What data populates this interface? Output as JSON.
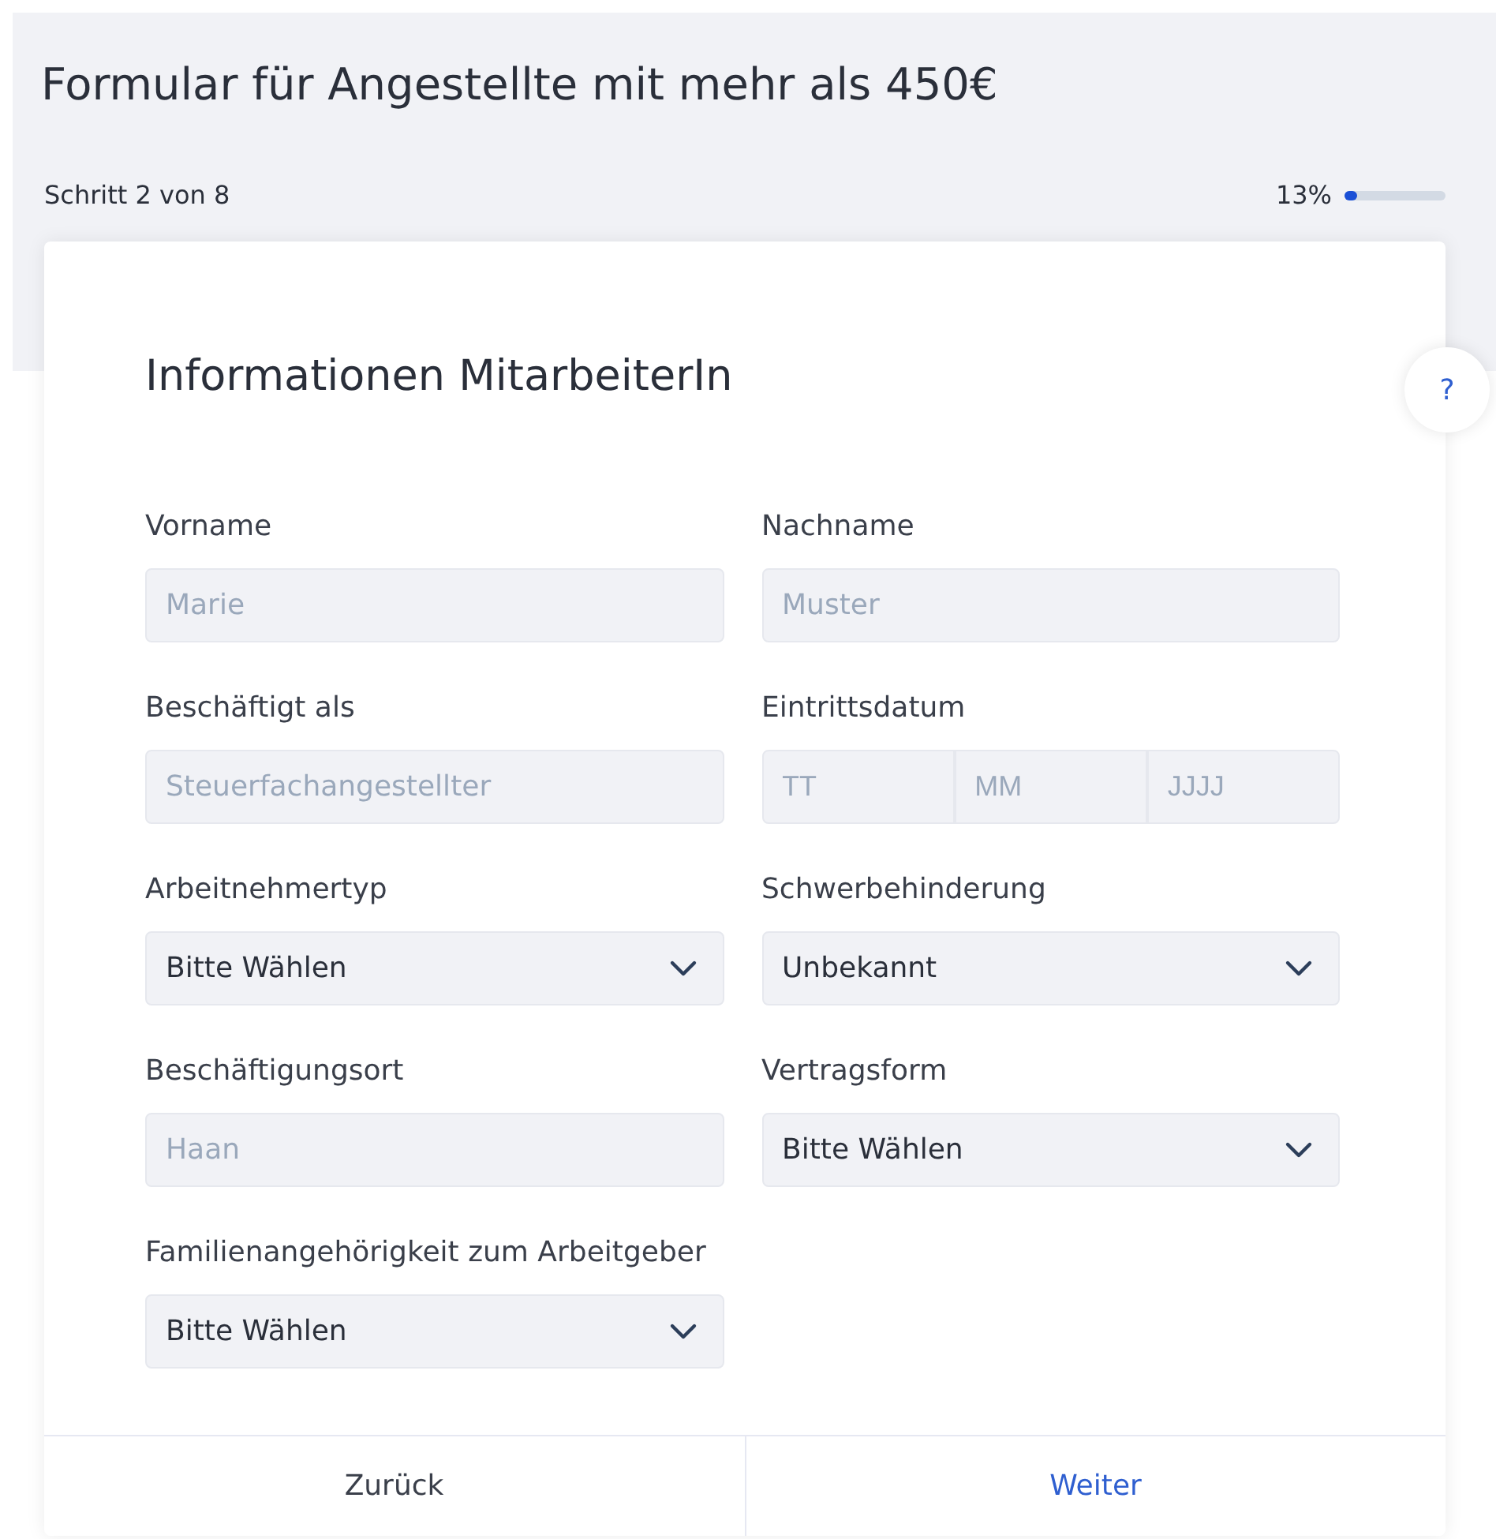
{
  "title": "Formular für Angestellte mit mehr als 450€",
  "progress": {
    "step": "Schritt 2 von 8",
    "percent": "13%",
    "level": 0.13
  },
  "help": "?",
  "card": {
    "heading": "Informationen MitarbeiterIn",
    "fields": [
      {
        "kind": "text",
        "label": "Vorname",
        "placeholder": "Marie"
      },
      {
        "kind": "text",
        "label": "Nachname",
        "placeholder": "Muster"
      },
      {
        "kind": "text",
        "label": "Beschäftigt als",
        "placeholder": "Steuerfachangestellter"
      },
      {
        "kind": "date",
        "label": "Eintrittsdatum",
        "parts": [
          {
            "placeholder": "TT"
          },
          {
            "placeholder": "MM"
          },
          {
            "placeholder": "JJJJ"
          }
        ]
      },
      {
        "kind": "select",
        "label": "Arbeitnehmertyp",
        "value": "Bitte Wählen"
      },
      {
        "kind": "select",
        "label": "Schwerbehinderung",
        "value": "Unbekannt"
      },
      {
        "kind": "text",
        "label": "Beschäftigungsort",
        "placeholder": "Haan"
      },
      {
        "kind": "select",
        "label": "Vertragsform",
        "value": "Bitte Wählen"
      },
      {
        "kind": "select",
        "label": "Familienangehörigkeit zum Arbeitgeber",
        "value": "Bitte Wählen"
      }
    ],
    "back": "Zurück",
    "next": "Weiter"
  }
}
